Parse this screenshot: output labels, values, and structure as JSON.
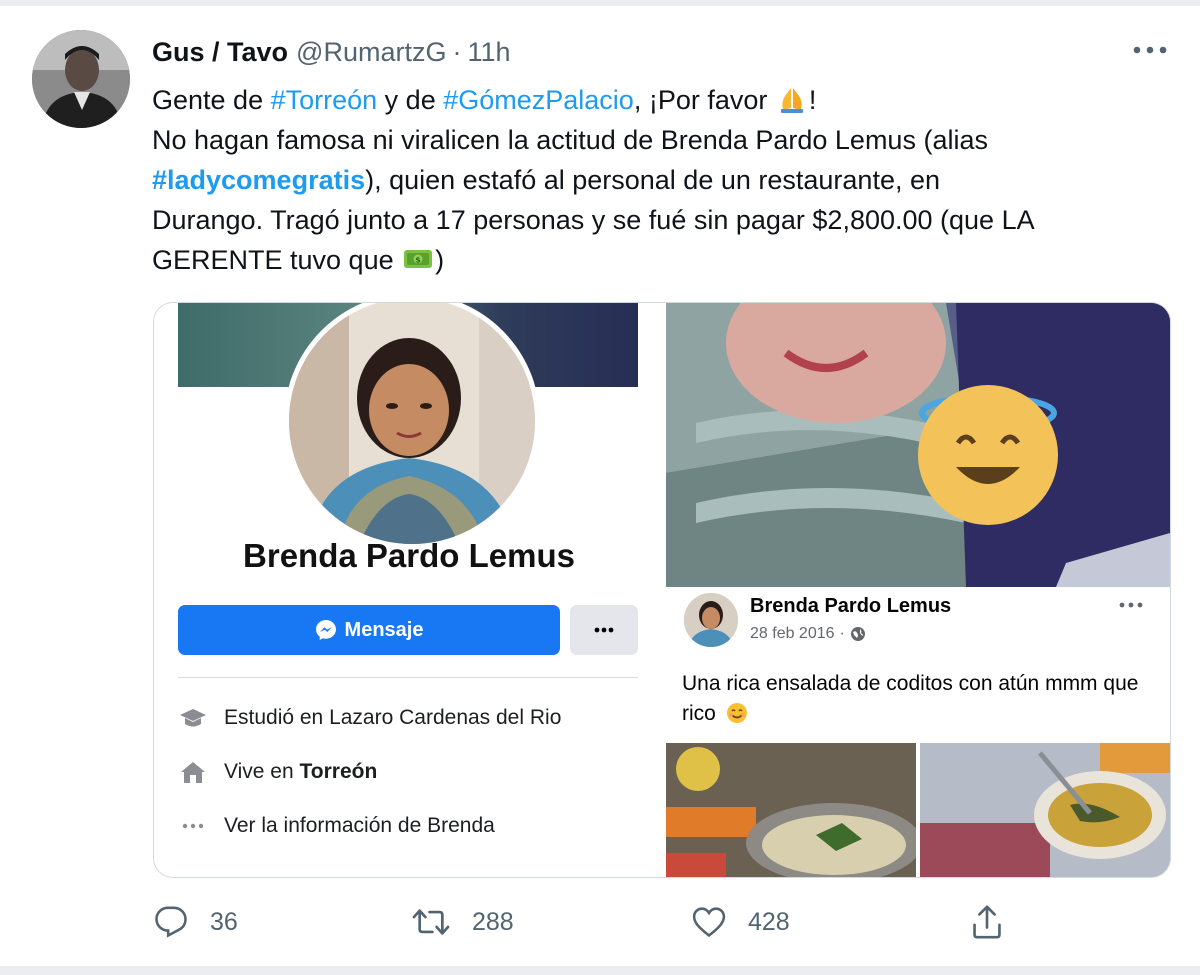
{
  "tweet": {
    "author": {
      "name": "Gus / Tavo",
      "handle": "@RumartzG",
      "separator": "·",
      "time": "11h"
    },
    "text": {
      "line1": {
        "a": "Gente de ",
        "tag1": "#Torreón",
        "b": " y de ",
        "tag2": "#GómezPalacio",
        "c": ", ¡Por favor ",
        "d": "!"
      },
      "line2": "No hagan famosa  ni viralicen la actitud de Brenda Pardo Lemus (alias",
      "line3": {
        "tag": "#ladycomegratis",
        "rest": "), quien estafó al personal de un restaurante, en"
      },
      "line4": "Durango. Tragó junto a 17 personas y se fué sin pagar $2,800.00 (que LA",
      "line5": {
        "a": "GERENTE tuvo que ",
        "b": ")"
      }
    },
    "emojis": {
      "pray": "folded-hands",
      "money": "dollar-banknote"
    },
    "actions": {
      "replies": "36",
      "retweets": "288",
      "likes": "428"
    }
  },
  "facebook_profile": {
    "name": "Brenda Pardo Lemus",
    "message_button": "Mensaje",
    "info": {
      "studied": "Estudió en Lazaro Cardenas del Rio",
      "lives_prefix": "Vive en ",
      "lives_city": "Torreón",
      "see_info": "Ver la información de Brenda"
    }
  },
  "facebook_post": {
    "author": "Brenda Pardo Lemus",
    "date": "28 feb 2016",
    "date_separator": "·",
    "body": "Una rica ensalada de coditos con atún mmm que rico"
  },
  "colors": {
    "twitter_blue": "#1d9bf0",
    "facebook_blue": "#1877f2",
    "secondary_text": "#536471"
  }
}
